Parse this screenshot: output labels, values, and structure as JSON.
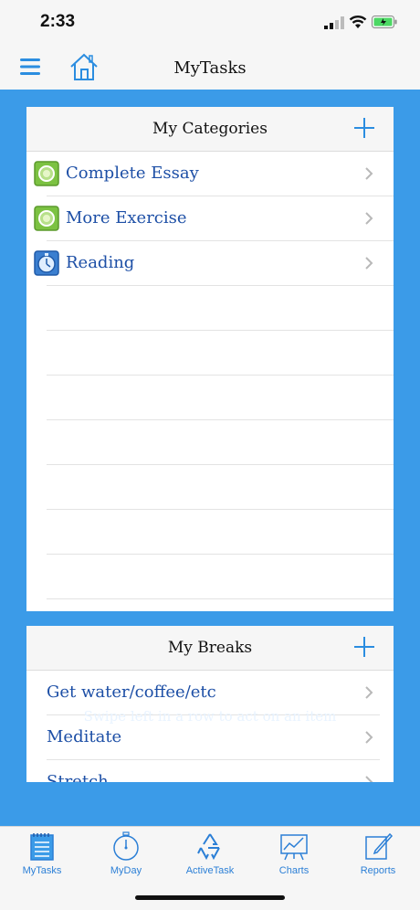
{
  "status": {
    "time": "2:33"
  },
  "nav": {
    "title": "MyTasks"
  },
  "categories": {
    "title": "My Categories",
    "items": [
      {
        "label": "Complete Essay",
        "icon": "green-target-icon"
      },
      {
        "label": "More Exercise",
        "icon": "green-target-icon"
      },
      {
        "label": "Reading",
        "icon": "blue-stopwatch-icon"
      }
    ]
  },
  "breaks": {
    "title": "My Breaks",
    "items": [
      {
        "label": "Get water/coffee/etc"
      },
      {
        "label": "Meditate"
      },
      {
        "label": "Stretch"
      }
    ]
  },
  "hint": "Swipe left in a row to act on an item",
  "tabs": [
    {
      "label": "MyTasks",
      "icon": "notepad-icon"
    },
    {
      "label": "MyDay",
      "icon": "stopwatch-icon"
    },
    {
      "label": "ActiveTask",
      "icon": "recycle-icon"
    },
    {
      "label": "Charts",
      "icon": "chart-easel-icon"
    },
    {
      "label": "Reports",
      "icon": "edit-report-icon"
    }
  ],
  "colors": {
    "accent": "#3b9be8",
    "link": "#1d4fa6",
    "tab": "#2b7fd6",
    "green": "#7cc242"
  }
}
